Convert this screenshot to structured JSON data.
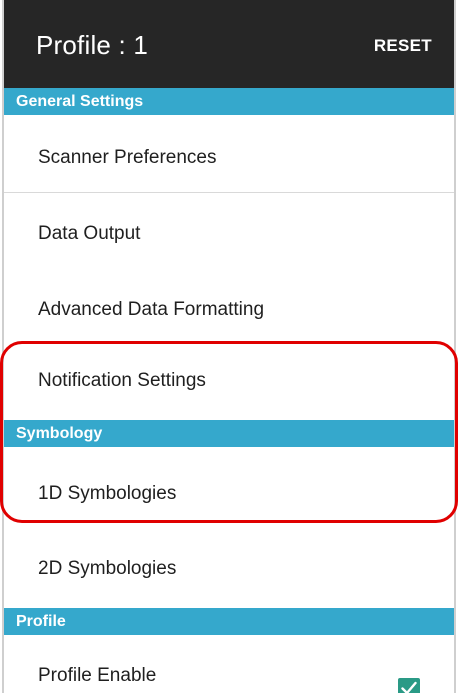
{
  "appbar": {
    "title": "Profile : 1",
    "reset_label": "RESET"
  },
  "sections": {
    "general": "General Settings",
    "symbology": "Symbology",
    "profile": "Profile"
  },
  "items": {
    "scanner_preferences": "Scanner Preferences",
    "data_output": "Data Output",
    "advanced_data_formatting": "Advanced Data Formatting",
    "notification_settings": "Notification Settings",
    "symbologies_1d": "1D Symbologies",
    "symbologies_2d": "2D Symbologies",
    "profile_enable": "Profile Enable"
  },
  "profile_enable_checked": true,
  "colors": {
    "appbar": "#262626",
    "section_header": "#35a8cc",
    "highlight_outline": "#e00000",
    "checkbox": "#2a9a86"
  }
}
